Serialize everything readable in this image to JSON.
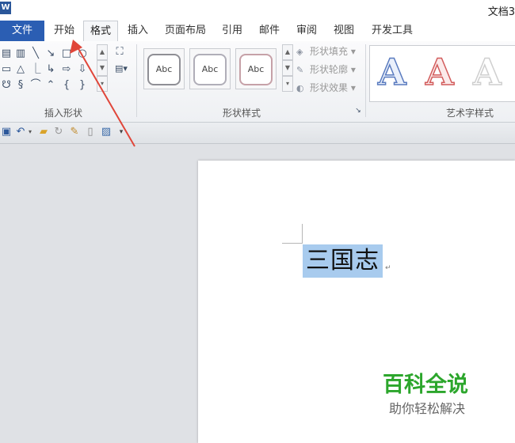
{
  "titlebar": {
    "app_icon": "W",
    "title": "文档3"
  },
  "tabs": [
    {
      "label": "文件"
    },
    {
      "label": "开始"
    },
    {
      "label": "格式"
    },
    {
      "label": "插入"
    },
    {
      "label": "页面布局"
    },
    {
      "label": "引用"
    },
    {
      "label": "邮件"
    },
    {
      "label": "审阅"
    },
    {
      "label": "视图"
    },
    {
      "label": "开发工具"
    }
  ],
  "ribbon": {
    "insert_shapes_label": "插入形状",
    "shape_styles_label": "形状样式",
    "wordart_label": "艺术字样式",
    "style_tiles": [
      {
        "label": "Abc"
      },
      {
        "label": "Abc"
      },
      {
        "label": "Abc"
      }
    ],
    "fill_label": "形状填充",
    "outline_label": "形状轮廓",
    "effect_label": "形状效果",
    "wordart_letters": [
      {
        "label": "A",
        "color": "#5a7bbf"
      },
      {
        "label": "A",
        "color": "#d25c5c"
      },
      {
        "label": "A",
        "color": "#dddddd"
      }
    ]
  },
  "document": {
    "selected_text": "三国志",
    "paragraph_mark": "↵"
  },
  "watermark": {
    "title": "百科全说",
    "subtitle": "助你轻松解决"
  },
  "colors": {
    "file_tab": "#2b5eb3",
    "selection": "#a8cbee",
    "watermark": "#2ca62c",
    "arrow": "#e0463a"
  }
}
